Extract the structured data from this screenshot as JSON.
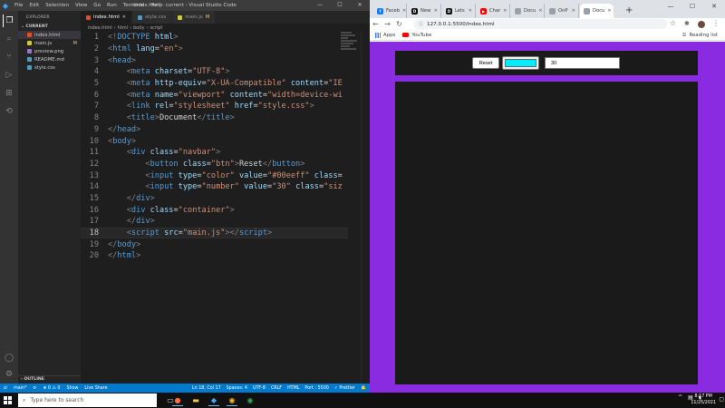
{
  "vscode": {
    "title": "index.html - current - Visual Studio Code",
    "menu": [
      "File",
      "Edit",
      "Selection",
      "View",
      "Go",
      "Run",
      "Terminal",
      "Help"
    ],
    "sidebar": {
      "title": "EXPLORER",
      "section": "CURRENT",
      "files": [
        {
          "name": "index.html",
          "badge": "",
          "color": "#e44d26"
        },
        {
          "name": "main.js",
          "badge": "M",
          "color": "#cbcb41"
        },
        {
          "name": "preview.png",
          "badge": "",
          "color": "#a074c4"
        },
        {
          "name": "README.md",
          "badge": "",
          "color": "#519aba"
        },
        {
          "name": "style.css",
          "badge": "",
          "color": "#519aba"
        }
      ],
      "outline": "OUTLINE"
    },
    "tabs": [
      {
        "label": "index.html",
        "mod": "",
        "color": "#e44d26"
      },
      {
        "label": "style.css",
        "mod": "",
        "color": "#519aba"
      },
      {
        "label": "main.js",
        "mod": "M",
        "color": "#cbcb41"
      }
    ],
    "breadcrumb": [
      "index.html",
      "html",
      "body",
      "script"
    ],
    "current_line": 18,
    "status": {
      "branch": "main*",
      "problems": "⊗ 0 ⚠ 0",
      "show": "Show",
      "live_share": "Live Share",
      "position": "Ln 18, Col 17",
      "spaces": "Spaces: 4",
      "encoding": "UTF-8",
      "eol": "CRLF",
      "language": "HTML",
      "port": "Port : 5500",
      "prettier": "✓ Prettier"
    }
  },
  "code_lines": [
    [
      [
        "t-br",
        "<!"
      ],
      [
        "t-tag",
        "DOCTYPE"
      ],
      [
        "t-txt",
        " "
      ],
      [
        "t-attr",
        "html"
      ],
      [
        "t-br",
        ">"
      ]
    ],
    [
      [
        "t-br",
        "<"
      ],
      [
        "t-tag",
        "html"
      ],
      [
        "t-txt",
        " "
      ],
      [
        "t-attr",
        "lang"
      ],
      [
        "t-txt",
        "="
      ],
      [
        "t-str",
        "\"en\""
      ],
      [
        "t-br",
        ">"
      ]
    ],
    [
      [
        "t-br",
        "<"
      ],
      [
        "t-tag",
        "head"
      ],
      [
        "t-br",
        ">"
      ]
    ],
    [
      [
        "t-txt",
        "    "
      ],
      [
        "t-br",
        "<"
      ],
      [
        "t-tag",
        "meta"
      ],
      [
        "t-txt",
        " "
      ],
      [
        "t-attr",
        "charset"
      ],
      [
        "t-txt",
        "="
      ],
      [
        "t-str",
        "\"UTF-8\""
      ],
      [
        "t-br",
        ">"
      ]
    ],
    [
      [
        "t-txt",
        "    "
      ],
      [
        "t-br",
        "<"
      ],
      [
        "t-tag",
        "meta"
      ],
      [
        "t-txt",
        " "
      ],
      [
        "t-attr",
        "http-equiv"
      ],
      [
        "t-txt",
        "="
      ],
      [
        "t-str",
        "\"X-UA-Compatible\""
      ],
      [
        "t-txt",
        " "
      ],
      [
        "t-attr",
        "content"
      ],
      [
        "t-txt",
        "="
      ],
      [
        "t-str",
        "\"IE"
      ]
    ],
    [
      [
        "t-txt",
        "    "
      ],
      [
        "t-br",
        "<"
      ],
      [
        "t-tag",
        "meta"
      ],
      [
        "t-txt",
        " "
      ],
      [
        "t-attr",
        "name"
      ],
      [
        "t-txt",
        "="
      ],
      [
        "t-str",
        "\"viewport\""
      ],
      [
        "t-txt",
        " "
      ],
      [
        "t-attr",
        "content"
      ],
      [
        "t-txt",
        "="
      ],
      [
        "t-str",
        "\"width=device-wi"
      ]
    ],
    [
      [
        "t-txt",
        "    "
      ],
      [
        "t-br",
        "<"
      ],
      [
        "t-tag",
        "link"
      ],
      [
        "t-txt",
        " "
      ],
      [
        "t-attr",
        "rel"
      ],
      [
        "t-txt",
        "="
      ],
      [
        "t-str",
        "\"stylesheet\""
      ],
      [
        "t-txt",
        " "
      ],
      [
        "t-attr",
        "href"
      ],
      [
        "t-txt",
        "="
      ],
      [
        "t-str",
        "\"style.css\""
      ],
      [
        "t-br",
        ">"
      ]
    ],
    [
      [
        "t-txt",
        "    "
      ],
      [
        "t-br",
        "<"
      ],
      [
        "t-tag",
        "title"
      ],
      [
        "t-br",
        ">"
      ],
      [
        "t-txt",
        "Document"
      ],
      [
        "t-br",
        "</"
      ],
      [
        "t-tag",
        "title"
      ],
      [
        "t-br",
        ">"
      ]
    ],
    [
      [
        "t-br",
        "</"
      ],
      [
        "t-tag",
        "head"
      ],
      [
        "t-br",
        ">"
      ]
    ],
    [
      [
        "t-br",
        "<"
      ],
      [
        "t-tag",
        "body"
      ],
      [
        "t-br",
        ">"
      ]
    ],
    [
      [
        "t-txt",
        "    "
      ],
      [
        "t-br",
        "<"
      ],
      [
        "t-tag",
        "div"
      ],
      [
        "t-txt",
        " "
      ],
      [
        "t-attr",
        "class"
      ],
      [
        "t-txt",
        "="
      ],
      [
        "t-str",
        "\"navbar\""
      ],
      [
        "t-br",
        ">"
      ]
    ],
    [
      [
        "t-txt",
        "        "
      ],
      [
        "t-br",
        "<"
      ],
      [
        "t-tag",
        "button"
      ],
      [
        "t-txt",
        " "
      ],
      [
        "t-attr",
        "class"
      ],
      [
        "t-txt",
        "="
      ],
      [
        "t-str",
        "\"btn\""
      ],
      [
        "t-br",
        ">"
      ],
      [
        "t-txt",
        "Reset"
      ],
      [
        "t-br",
        "</"
      ],
      [
        "t-tag",
        "button"
      ],
      [
        "t-br",
        ">"
      ]
    ],
    [
      [
        "t-txt",
        "        "
      ],
      [
        "t-br",
        "<"
      ],
      [
        "t-tag",
        "input"
      ],
      [
        "t-txt",
        " "
      ],
      [
        "t-attr",
        "type"
      ],
      [
        "t-txt",
        "="
      ],
      [
        "t-str",
        "\"color\""
      ],
      [
        "t-txt",
        " "
      ],
      [
        "t-attr",
        "value"
      ],
      [
        "t-txt",
        "="
      ],
      [
        "t-str",
        "\"#00eeff\""
      ],
      [
        "t-txt",
        " "
      ],
      [
        "t-attr",
        "class"
      ],
      [
        "t-txt",
        "="
      ]
    ],
    [
      [
        "t-txt",
        "        "
      ],
      [
        "t-br",
        "<"
      ],
      [
        "t-tag",
        "input"
      ],
      [
        "t-txt",
        " "
      ],
      [
        "t-attr",
        "type"
      ],
      [
        "t-txt",
        "="
      ],
      [
        "t-str",
        "\"number\""
      ],
      [
        "t-txt",
        " "
      ],
      [
        "t-attr",
        "value"
      ],
      [
        "t-txt",
        "="
      ],
      [
        "t-str",
        "\"30\""
      ],
      [
        "t-txt",
        " "
      ],
      [
        "t-attr",
        "class"
      ],
      [
        "t-txt",
        "="
      ],
      [
        "t-str",
        "\"siz"
      ]
    ],
    [
      [
        "t-txt",
        "    "
      ],
      [
        "t-br",
        "</"
      ],
      [
        "t-tag",
        "div"
      ],
      [
        "t-br",
        ">"
      ]
    ],
    [
      [
        "t-txt",
        "    "
      ],
      [
        "t-br",
        "<"
      ],
      [
        "t-tag",
        "div"
      ],
      [
        "t-txt",
        " "
      ],
      [
        "t-attr",
        "class"
      ],
      [
        "t-txt",
        "="
      ],
      [
        "t-str",
        "\"container\""
      ],
      [
        "t-br",
        ">"
      ]
    ],
    [
      [
        "t-txt",
        "    "
      ],
      [
        "t-br",
        "</"
      ],
      [
        "t-tag",
        "div"
      ],
      [
        "t-br",
        ">"
      ]
    ],
    [
      [
        "t-txt",
        "    "
      ],
      [
        "t-br",
        "<"
      ],
      [
        "t-tag",
        "script"
      ],
      [
        "t-txt",
        " "
      ],
      [
        "t-attr",
        "src"
      ],
      [
        "t-txt",
        "="
      ],
      [
        "t-str",
        "\"main.js\""
      ],
      [
        "t-br",
        "></"
      ],
      [
        "t-tag",
        "script"
      ],
      [
        "t-br",
        ">"
      ]
    ],
    [
      [
        "t-br",
        "</"
      ],
      [
        "t-tag",
        "body"
      ],
      [
        "t-br",
        ">"
      ]
    ],
    [
      [
        "t-br",
        "</"
      ],
      [
        "t-tag",
        "html"
      ],
      [
        "t-br",
        ">"
      ]
    ]
  ],
  "chrome": {
    "tabs": [
      {
        "label": "Faceb",
        "fav": "f",
        "color": "#1877f2"
      },
      {
        "label": "New",
        "fav": "D",
        "color": "#111111"
      },
      {
        "label": "Lets",
        "fav": "D",
        "color": "#111111"
      },
      {
        "label": "Char",
        "fav": "▶",
        "color": "#ff0000"
      },
      {
        "label": "Docu",
        "fav": "",
        "color": "#9aa0a6"
      },
      {
        "label": "OnP",
        "fav": "",
        "color": "#9aa0a6"
      },
      {
        "label": "Docu",
        "fav": "",
        "color": "#9aa0a6"
      }
    ],
    "url": "127.0.0.1:5500/index.html",
    "bookmarks": {
      "apps": "Apps",
      "youtube": "YouTube",
      "reading_list": "Reading list"
    }
  },
  "page": {
    "reset_label": "Reset",
    "color_value": "#00eeff",
    "size_value": "30",
    "background": "#8a2be2"
  },
  "taskbar": {
    "search_placeholder": "Type here to search",
    "time": "8:17 PM",
    "date": "11/25/2021"
  }
}
